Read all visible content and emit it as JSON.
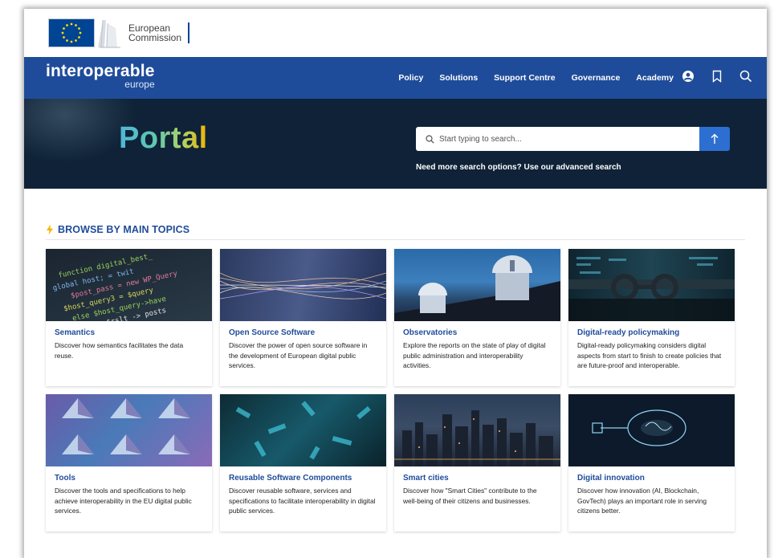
{
  "ec": {
    "line1": "European",
    "line2": "Commission"
  },
  "brand": {
    "main": "interoperable",
    "sub": "europe"
  },
  "nav": {
    "links": [
      "Policy",
      "Solutions",
      "Support Centre",
      "Governance",
      "Academy"
    ],
    "icons": [
      "user-icon",
      "bookmark-icon",
      "search-icon"
    ]
  },
  "hero": {
    "title": "Portal",
    "search_placeholder": "Start typing to search...",
    "adv_prefix": "Need more search options? Use our ",
    "adv_link": "advanced search"
  },
  "topics": {
    "heading": "BROWSE BY MAIN TOPICS",
    "cards": [
      {
        "title": "Semantics",
        "desc": "Discover how semantics facilitates the data reuse."
      },
      {
        "title": "Open Source Software",
        "desc": "Discover the power of open source software in the development of European digital public services."
      },
      {
        "title": "Observatories",
        "desc": "Explore the reports on the state of play of digital public administration and interoperability activities."
      },
      {
        "title": "Digital-ready policymaking",
        "desc": "Digital-ready policymaking considers digital aspects from start to finish to create policies that are future-proof and interoperable."
      },
      {
        "title": "Tools",
        "desc": "Discover the tools and specifications to help achieve interoperability in the EU digital public services."
      },
      {
        "title": "Reusable Software Components",
        "desc": "Discover reusable software, services and specifications to facilitate interoperability in digital public services."
      },
      {
        "title": "Smart cities",
        "desc": "Discover how \"Smart Cities\" contribute to the well-being of their citizens and businesses."
      },
      {
        "title": "Digital innovation",
        "desc": "Discover how innovation (AI, Blockchain, GovTech) plays an important role in serving citizens better."
      }
    ]
  },
  "colors": {
    "nav_blue": "#1f4c9a",
    "hero_bg": "#0f2237",
    "search_button": "#2d6fd0",
    "accent_orange": "#f4b400"
  }
}
